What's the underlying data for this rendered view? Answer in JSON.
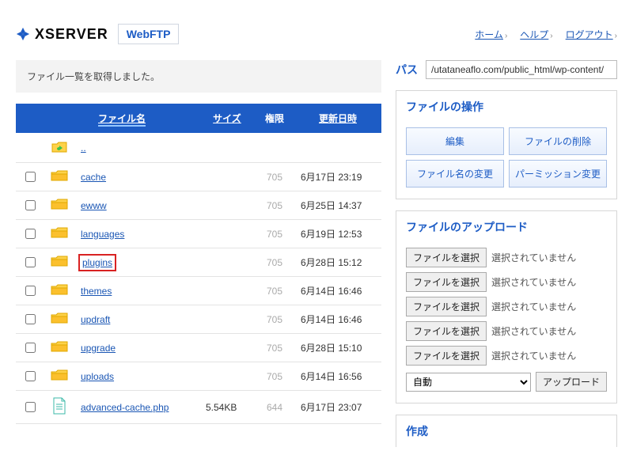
{
  "header": {
    "brand": "XSERVER",
    "product": "WebFTP",
    "links": {
      "home": "ホーム",
      "help": "ヘルプ",
      "logout": "ログアウト"
    }
  },
  "notice": "ファイル一覧を取得しました。",
  "columns": {
    "name": "ファイル名",
    "size": "サイズ",
    "perm": "権限",
    "date": "更新日時"
  },
  "parent_link": "..",
  "files": [
    {
      "type": "folder",
      "name": "cache",
      "size": "",
      "perm": "705",
      "date": "6月17日 23:19"
    },
    {
      "type": "folder",
      "name": "ewww",
      "size": "",
      "perm": "705",
      "date": "6月25日 14:37"
    },
    {
      "type": "folder",
      "name": "languages",
      "size": "",
      "perm": "705",
      "date": "6月19日 12:53"
    },
    {
      "type": "folder",
      "name": "plugins",
      "size": "",
      "perm": "705",
      "date": "6月28日 15:12",
      "highlight": true
    },
    {
      "type": "folder",
      "name": "themes",
      "size": "",
      "perm": "705",
      "date": "6月14日 16:46"
    },
    {
      "type": "folder",
      "name": "updraft",
      "size": "",
      "perm": "705",
      "date": "6月14日 16:46"
    },
    {
      "type": "folder",
      "name": "upgrade",
      "size": "",
      "perm": "705",
      "date": "6月28日 15:10"
    },
    {
      "type": "folder",
      "name": "uploads",
      "size": "",
      "perm": "705",
      "date": "6月14日 16:56"
    },
    {
      "type": "file",
      "name": "advanced-cache.php",
      "size": "5.54KB",
      "perm": "644",
      "date": "6月17日 23:07"
    }
  ],
  "path": {
    "label": "パス",
    "value": "/utataneaflo.com/public_html/wp-content/"
  },
  "ops_panel": {
    "title": "ファイルの操作",
    "buttons": {
      "edit": "編集",
      "delete": "ファイルの削除",
      "rename": "ファイル名の変更",
      "chmod": "パーミッション変更"
    }
  },
  "upload_panel": {
    "title": "ファイルのアップロード",
    "browse": "ファイルを選択",
    "nosel": "選択されていません",
    "encoding_options": [
      "自動"
    ],
    "encoding_selected": "自動",
    "submit": "アップロード"
  },
  "create_panel": {
    "title": "作成"
  }
}
